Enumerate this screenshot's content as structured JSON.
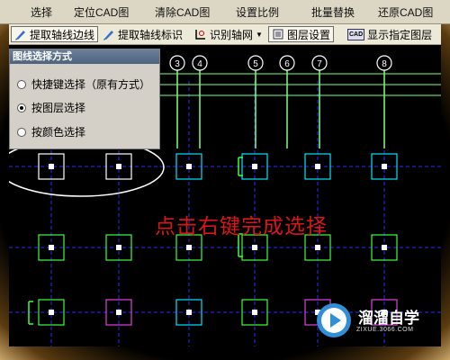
{
  "top_toolbar": {
    "items": [
      "选择",
      "定位CAD图",
      "清除CAD图",
      "设置比例",
      "批量替换",
      "还原CAD图"
    ]
  },
  "toolbar": {
    "extract_axis_lines": "提取轴线边线",
    "extract_axis_labels": "提取轴线标识",
    "identify_axis_grid": "识别轴网",
    "layer_settings": "图层设置",
    "cad_badge": "CAD",
    "show_layer": "显示指定图层"
  },
  "panel": {
    "title": "图线选择方式",
    "options": [
      {
        "label": "快捷键选择（原有方式）",
        "selected": false
      },
      {
        "label": "按图层选择",
        "selected": true
      },
      {
        "label": "按颜色选择",
        "selected": false
      }
    ]
  },
  "axis_labels": [
    "3",
    "4",
    "5",
    "6",
    "7",
    "8"
  ],
  "hint": "点击右键完成选择",
  "watermark": {
    "name": "溜溜自学",
    "url": "ZIXUE.3066.COM"
  },
  "colors": {
    "grid_line": "#2b2bff",
    "axis_line": "#7cff7c",
    "column_cyan": "#00e5ff",
    "column_green": "#3cff3c",
    "column_magenta": "#e040e0",
    "hint_red": "#d81818"
  }
}
